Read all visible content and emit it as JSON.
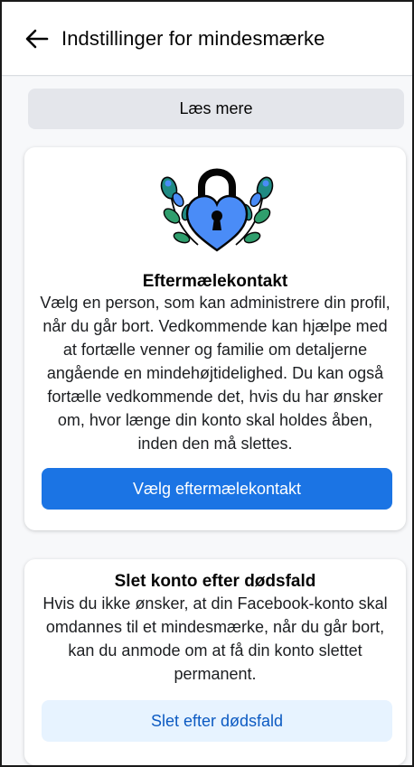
{
  "header": {
    "back_icon": "arrow-left-icon",
    "title": "Indstillinger for mindesmærke"
  },
  "read_more": {
    "label": "Læs mere"
  },
  "legacy_contact": {
    "illustration": "heart-padlock-icon",
    "title": "Eftermælekontakt",
    "description": "Vælg en person, som kan administrere din profil, når du går bort. Vedkommende kan hjælpe med at fortælle venner og familie om detaljerne angående en mindehøjtidelighed. Du kan også fortælle vedkommende det, hvis du har ønsker om, hvor længe din konto skal holdes åben, inden den må slettes.",
    "button_label": "Vælg eftermælekontakt"
  },
  "delete_after_death": {
    "title": "Slet konto efter dødsfald",
    "description": "Hvis du ikke ønsker, at din Facebook-konto skal omdannes til et mindesmærke, når du går bort, kan du anmode om at få din konto slettet permanent.",
    "button_label": "Slet efter dødsfald"
  },
  "colors": {
    "primary": "#1b74e4",
    "secondary_bg": "#e7f3ff",
    "secondary_text": "#0c5ac2",
    "heart": "#4a8cf7",
    "leaf": "#1f8a83"
  }
}
